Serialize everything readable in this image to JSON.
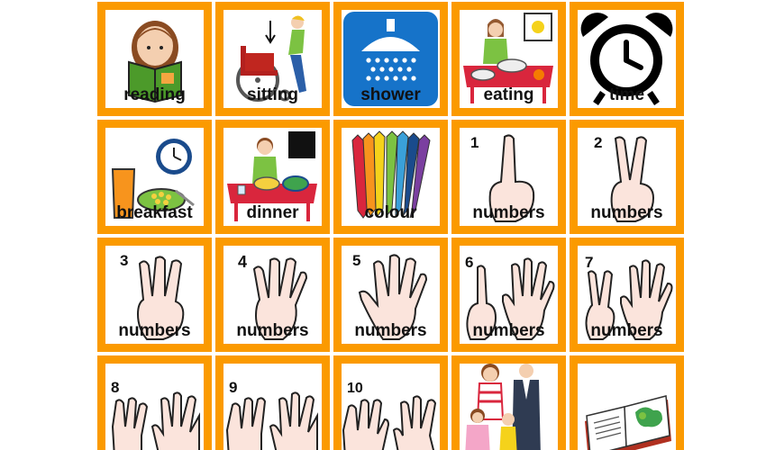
{
  "board": {
    "border_color": "#fb9a00",
    "tiles": [
      {
        "label": "reading",
        "icon": "reading-icon"
      },
      {
        "label": "sitting",
        "icon": "sitting-icon"
      },
      {
        "label": "shower",
        "icon": "shower-icon"
      },
      {
        "label": "eating",
        "icon": "eating-icon"
      },
      {
        "label": "time",
        "icon": "alarm-clock-icon"
      },
      {
        "label": "breakfast",
        "icon": "breakfast-icon"
      },
      {
        "label": "dinner",
        "icon": "dinner-icon"
      },
      {
        "label": "colour",
        "icon": "colour-pencils-icon"
      },
      {
        "label": "numbers",
        "icon": "hand-one-icon",
        "digit": "1"
      },
      {
        "label": "numbers",
        "icon": "hand-two-icon",
        "digit": "2"
      },
      {
        "label": "numbers",
        "icon": "hand-three-icon",
        "digit": "3"
      },
      {
        "label": "numbers",
        "icon": "hand-four-icon",
        "digit": "4"
      },
      {
        "label": "numbers",
        "icon": "hand-five-icon",
        "digit": "5"
      },
      {
        "label": "numbers",
        "icon": "hand-six-icon",
        "digit": "6"
      },
      {
        "label": "numbers",
        "icon": "hand-seven-icon",
        "digit": "7"
      },
      {
        "label": "",
        "icon": "hand-eight-icon",
        "digit": "8"
      },
      {
        "label": "",
        "icon": "hand-nine-icon",
        "digit": "9"
      },
      {
        "label": "",
        "icon": "hand-ten-icon",
        "digit": "10"
      },
      {
        "label": "",
        "icon": "family-icon"
      },
      {
        "label": "",
        "icon": "open-book-icon"
      }
    ]
  }
}
